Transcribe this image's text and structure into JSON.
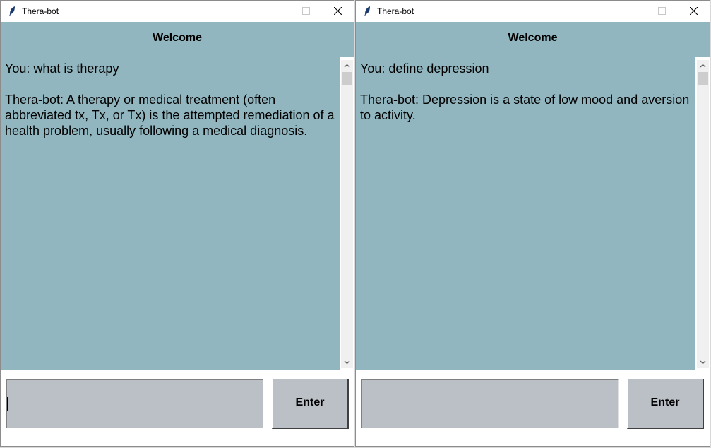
{
  "windows": [
    {
      "title": "Thera-bot",
      "header": "Welcome",
      "user_message": "You: what is therapy",
      "bot_message": "Thera-bot: A therapy or medical treatment (often abbreviated tx, Tx, or Tx) is the attempted remediation of a health problem, usually following a medical diagnosis.",
      "input_value": "",
      "enter_label": "Enter"
    },
    {
      "title": "Thera-bot",
      "header": "Welcome",
      "user_message": "You: define depression",
      "bot_message": "Thera-bot: Depression is a state of low mood and aversion to activity.",
      "input_value": "",
      "enter_label": "Enter"
    }
  ],
  "colors": {
    "chat_background": "#91b6bf",
    "input_background": "#bbc0c7",
    "window_background": "#ffffff"
  },
  "icons": {
    "app": "feather-icon",
    "minimize": "minimize-icon",
    "maximize": "maximize-icon",
    "close": "close-icon",
    "scroll_up": "chevron-up-icon",
    "scroll_down": "chevron-down-icon"
  }
}
